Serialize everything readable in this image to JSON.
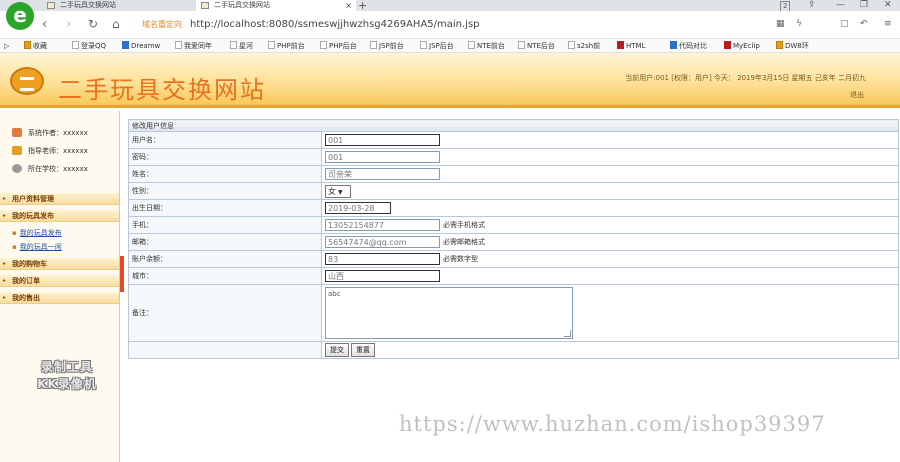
{
  "browser": {
    "logo_letter": "e",
    "tabs": [
      {
        "label": "二手玩具交换网站"
      },
      {
        "label": "二手玩具交换网站",
        "close": "×"
      }
    ],
    "new_tab": "+",
    "url_warning": "域名重定向",
    "url": "http://localhost:8080/ssmeswjjhwzhsg4269AHA5/main.jsp",
    "window_badge": "2",
    "bookmarks": [
      "收藏",
      "登录QQ",
      "Dreamw",
      "我爱同年",
      "星河",
      "PHP前台",
      "PHP后台",
      "JSP前台",
      "JSP后台",
      "NTE前台",
      "NTE后台",
      "s2sh前",
      "HTML",
      "代码对比",
      "MyEclip",
      "DW8环"
    ]
  },
  "header": {
    "site_title": "二手玩具交换网站",
    "user_info": "当前用户:001 [权限：用户] 今天： 2019年3月15日 星期五 己亥年 二月初九",
    "logout": "退出"
  },
  "sidebar": {
    "info": [
      {
        "label": "系统作者：xxxxxx"
      },
      {
        "label": "指导老师：xxxxxx"
      },
      {
        "label": "所在学校：xxxxxx"
      }
    ],
    "menus": [
      {
        "label": "用户资料管理"
      },
      {
        "label": "我的玩具发布"
      },
      {
        "label": "我的购物车"
      },
      {
        "label": "我的订单"
      },
      {
        "label": "我的售出"
      }
    ],
    "submenus": [
      {
        "label": "我的玩具发布"
      },
      {
        "label": "我的玩具一闲"
      }
    ],
    "watermark": [
      "录制工具",
      "KK录像机"
    ]
  },
  "form": {
    "title": "修改用户信息",
    "fields": {
      "username": {
        "label": "用户名：",
        "value": "001"
      },
      "password": {
        "label": "密码：",
        "value": "001"
      },
      "name": {
        "label": "姓名：",
        "value": "司亲荣"
      },
      "gender": {
        "label": "性别：",
        "value": "女"
      },
      "birthday": {
        "label": "出生日期：",
        "value": "2019-03-28"
      },
      "phone": {
        "label": "手机：",
        "value": "13052154877",
        "hint": "必需手机格式"
      },
      "email": {
        "label": "邮箱：",
        "value": "56547474@qq.com",
        "hint": "必需邮箱格式"
      },
      "balance": {
        "label": "账户余额：",
        "value": "83",
        "hint": "必需数字型"
      },
      "city": {
        "label": "城市：",
        "value": "山西"
      },
      "remark": {
        "label": "备注：",
        "value": "abc"
      }
    },
    "submit": "提交",
    "reset": "重置"
  },
  "watermark_url": "https://www.huzhan.com/ishop39397"
}
